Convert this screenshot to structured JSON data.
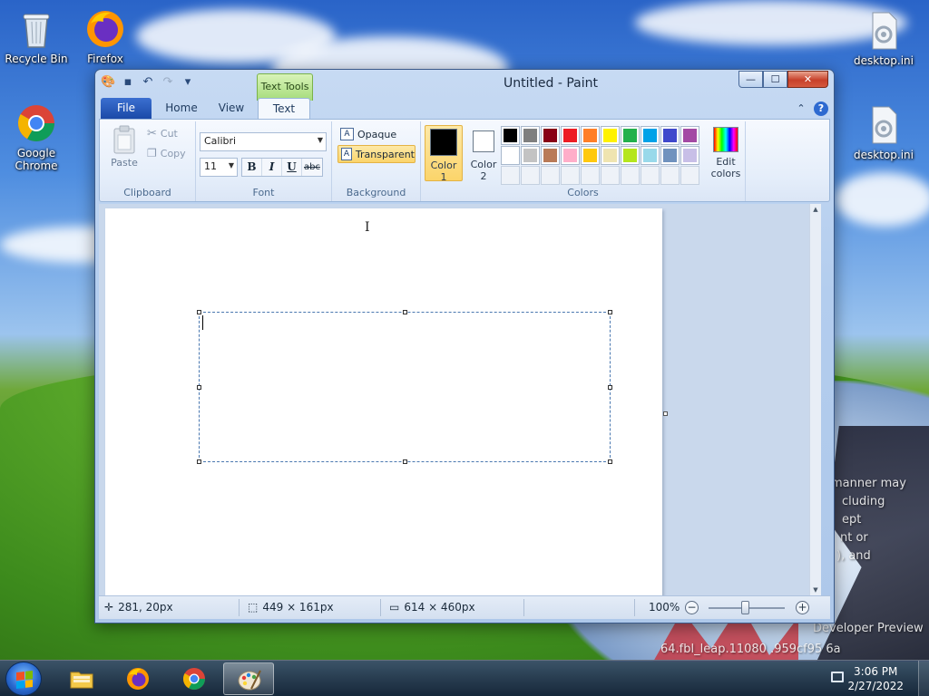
{
  "desktop": {
    "icons": [
      {
        "label": "Recycle Bin"
      },
      {
        "label": "Firefox"
      },
      {
        "label": "Google Chrome"
      },
      {
        "label": "desktop.ini"
      },
      {
        "label": "desktop.ini"
      }
    ],
    "watermark": {
      "lines": [
        "manner may",
        "cluding",
        "ept",
        "nt or",
        "), and"
      ],
      "build": "Developer Preview",
      "build_id": "64.fbl_leap.11080 .959cf95 6a"
    }
  },
  "window": {
    "title": "Untitled - Paint",
    "contextual_tab": "Text Tools",
    "controls": {
      "minimize": "—",
      "maximize": "☐",
      "close": "✕"
    }
  },
  "tabs": [
    {
      "label": "File"
    },
    {
      "label": "Home"
    },
    {
      "label": "View"
    },
    {
      "label": "Text",
      "active": true
    }
  ],
  "ribbon": {
    "clipboard": {
      "label": "Clipboard",
      "paste": "Paste",
      "cut": "Cut",
      "copy": "Copy"
    },
    "font": {
      "label": "Font",
      "family": "Calibri",
      "size": "11",
      "bold": "B",
      "italic": "I",
      "underline": "U",
      "strikethrough": "abc"
    },
    "background": {
      "label": "Background",
      "opaque": "Opaque",
      "transparent": "Transparent",
      "selected": "Transparent"
    },
    "colors": {
      "label": "Colors",
      "color1_label": "Color",
      "color1_num": "1",
      "color2_label": "Color",
      "color2_num": "2",
      "color1": "#000000",
      "color2": "#ffffff",
      "palette": [
        "#000000",
        "#7f7f7f",
        "#880015",
        "#ed1c24",
        "#ff7f27",
        "#fff200",
        "#22b14c",
        "#00a2e8",
        "#3f48cc",
        "#a349a4",
        "#ffffff",
        "#c3c3c3",
        "#b97a57",
        "#ffaec9",
        "#ffc90e",
        "#efe4b0",
        "#b5e61d",
        "#99d9ea",
        "#7092be",
        "#c8bfe7"
      ],
      "edit_line1": "Edit",
      "edit_line2": "colors"
    }
  },
  "status": {
    "cursor_pos": "281, 20px",
    "selection_size": "449 × 161px",
    "image_size": "614 × 460px",
    "zoom": "100%"
  },
  "taskbar": {
    "apps": [
      {
        "name": "File Explorer",
        "icon": "folder-icon"
      },
      {
        "name": "Firefox",
        "icon": "firefox-icon"
      },
      {
        "name": "Google Chrome",
        "icon": "chrome-icon"
      },
      {
        "name": "Paint",
        "icon": "paint-icon",
        "active": true
      }
    ],
    "time": "3:06 PM",
    "date": "2/27/2022"
  }
}
